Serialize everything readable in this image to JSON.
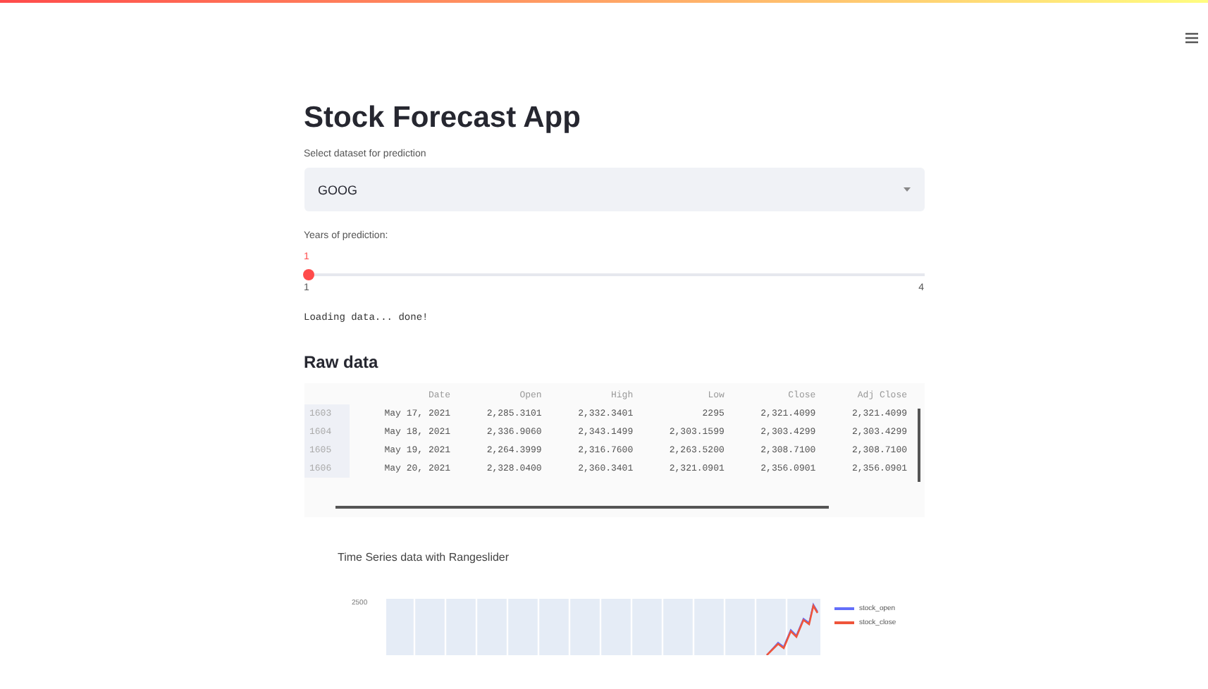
{
  "title": "Stock Forecast App",
  "dataset_select": {
    "label": "Select dataset for prediction",
    "value": "GOOG"
  },
  "years_slider": {
    "label": "Years of prediction:",
    "value": "1",
    "min": "1",
    "max": "4",
    "level": 0
  },
  "status": "Loading data... done!",
  "raw_data": {
    "heading": "Raw data",
    "columns": [
      "Date",
      "Open",
      "High",
      "Low",
      "Close",
      "Adj Close"
    ],
    "rows": [
      {
        "index": "1603",
        "cells": [
          "May 17, 2021",
          "2,285.3101",
          "2,332.3401",
          "2295",
          "2,321.4099",
          "2,321.4099"
        ]
      },
      {
        "index": "1604",
        "cells": [
          "May 18, 2021",
          "2,336.9060",
          "2,343.1499",
          "2,303.1599",
          "2,303.4299",
          "2,303.4299"
        ]
      },
      {
        "index": "1605",
        "cells": [
          "May 19, 2021",
          "2,264.3999",
          "2,316.7600",
          "2,263.5200",
          "2,308.7100",
          "2,308.7100"
        ]
      },
      {
        "index": "1606",
        "cells": [
          "May 20, 2021",
          "2,328.0400",
          "2,360.3401",
          "2,321.0901",
          "2,356.0901",
          "2,356.0901"
        ]
      }
    ]
  },
  "chart": {
    "title": "Time Series data with Rangeslider",
    "ytick": "2500",
    "legend": [
      {
        "name": "stock_open",
        "color": "#636efa"
      },
      {
        "name": "stock_close",
        "color": "#ef553b"
      }
    ]
  }
}
